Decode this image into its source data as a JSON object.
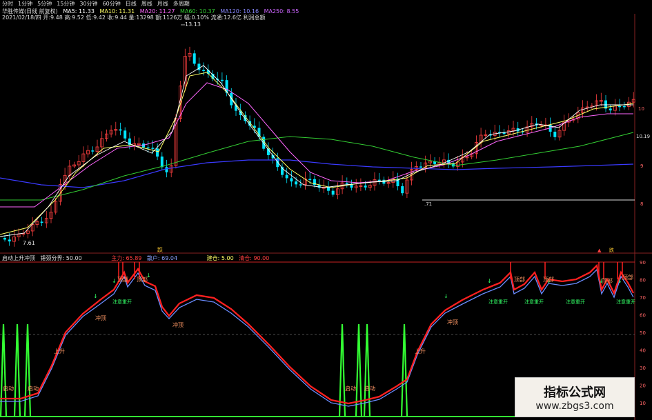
{
  "toolbar": [
    "分时",
    "1分钟",
    "5分钟",
    "15分钟",
    "30分钟",
    "60分钟",
    "日线",
    "周线",
    "月线",
    "多周期"
  ],
  "main_header": {
    "stock": "华胜传媒(日线 前复权)",
    "ma5": "MA5: 11.33",
    "ma10": "MA10: 11.31",
    "ma20": "MA20: 11.27",
    "ma60": "MA60: 10.37",
    "ma120": "MA120: 10.16",
    "ma250": "MA250: 8.55",
    "quote_line": "2021/02/18/四  开:9.48  高:9.52  低:9.42  收:9.44  量:13298  额:1126万  幅:0.10%  流通:12.6亿  利润总额"
  },
  "price_labels": {
    "high": "13.13",
    "low": "7.61",
    "support": ".71",
    "marker_top": "跌"
  },
  "right_axis_main": [
    "10",
    "10.19",
    "9",
    "8"
  ],
  "indicator_header": {
    "name": "启动上升冲顶",
    "boundary": "锤颈分界: 50.00",
    "main_force": "主力: 65.89",
    "retail": "散户: 69.04",
    "build": "建仓: 5.00",
    "clear": "清仓: 90.00"
  },
  "right_axis_ind": [
    "90",
    "80",
    "70",
    "60",
    "50",
    "40",
    "30",
    "20",
    "10"
  ],
  "annotations": {
    "start": "启动",
    "rise": "上升",
    "top": "冲顶",
    "peak": "顶部",
    "caution": "注意重开"
  },
  "watermark": {
    "line1": "指标公式网",
    "line2": "www.zbgs3.com"
  },
  "colors": {
    "up": "#ff4040",
    "down": "#00e5ff",
    "main_force": "#ff2020",
    "retail": "#6a8cff",
    "start_signal": "#33ff33",
    "ma5": "#ffffff",
    "ma10": "#ffff66",
    "ma20": "#ff66ff",
    "ma60": "#33cc33",
    "ma120": "#3a3aff"
  }
}
